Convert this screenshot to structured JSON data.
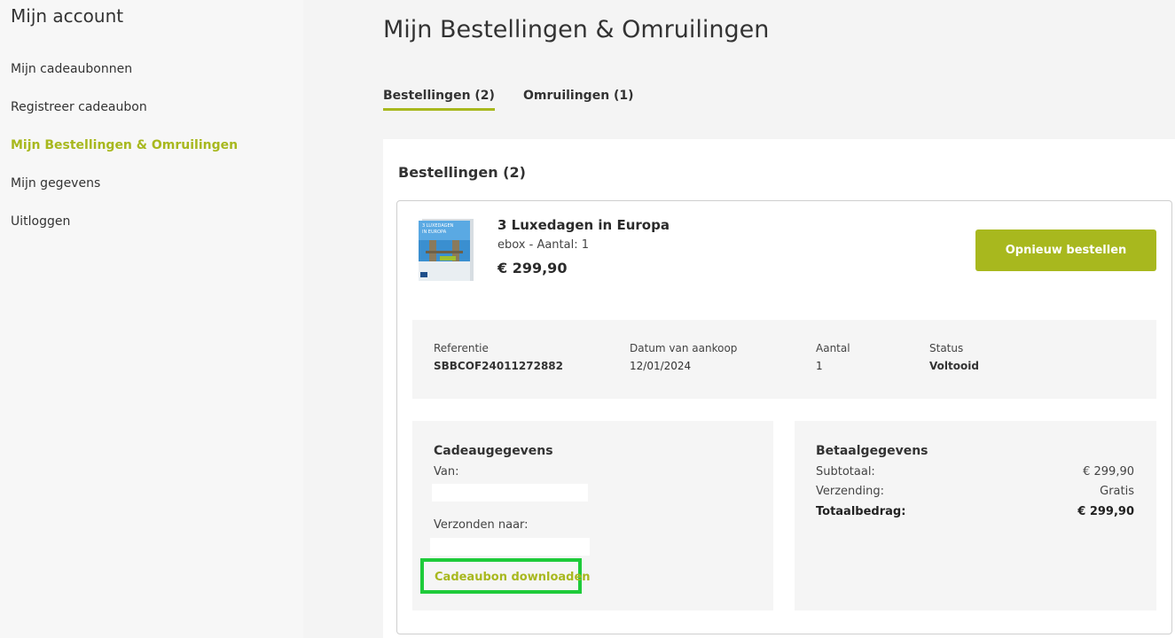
{
  "sidebar": {
    "title": "Mijn account",
    "items": [
      {
        "label": "Mijn cadeaubonnen"
      },
      {
        "label": "Registreer cadeaubon"
      },
      {
        "label": "Mijn Bestellingen & Omruilingen"
      },
      {
        "label": "Mijn gegevens"
      },
      {
        "label": "Uitloggen"
      }
    ]
  },
  "main": {
    "title": "Mijn Bestellingen & Omruilingen",
    "tabs": [
      {
        "label": "Bestellingen (2)"
      },
      {
        "label": "Omruilingen (1)"
      }
    ],
    "section_title": "Bestellingen (2)",
    "order": {
      "image_text_line1": "3 LUXEDAGEN",
      "image_text_line2": "IN EUROPA",
      "product_name": "3 Luxedagen in Europa",
      "product_meta": "ebox - Aantal: 1",
      "price": "€ 299,90",
      "reorder_label": "Opnieuw bestellen",
      "info": {
        "ref_label": "Referentie",
        "ref_value": "SBBCOF24011272882",
        "date_label": "Datum van aankoop",
        "date_value": "12/01/2024",
        "qty_label": "Aantal",
        "qty_value": "1",
        "status_label": "Status",
        "status_value": "Voltooid"
      },
      "gift": {
        "title": "Cadeaugegevens",
        "from_label": "Van:",
        "to_label": "Verzonden naar:",
        "download_label": "Cadeaubon downloaden"
      },
      "payment": {
        "title": "Betaalgegevens",
        "subtotal_label": "Subtotaal:",
        "subtotal_value": "€ 299,90",
        "shipping_label": "Verzending:",
        "shipping_value": "Gratis",
        "total_label": "Totaalbedrag:",
        "total_value": "€ 299,90"
      }
    }
  },
  "colors": {
    "accent": "#a8b81e",
    "highlight": "#1ecb3a"
  }
}
